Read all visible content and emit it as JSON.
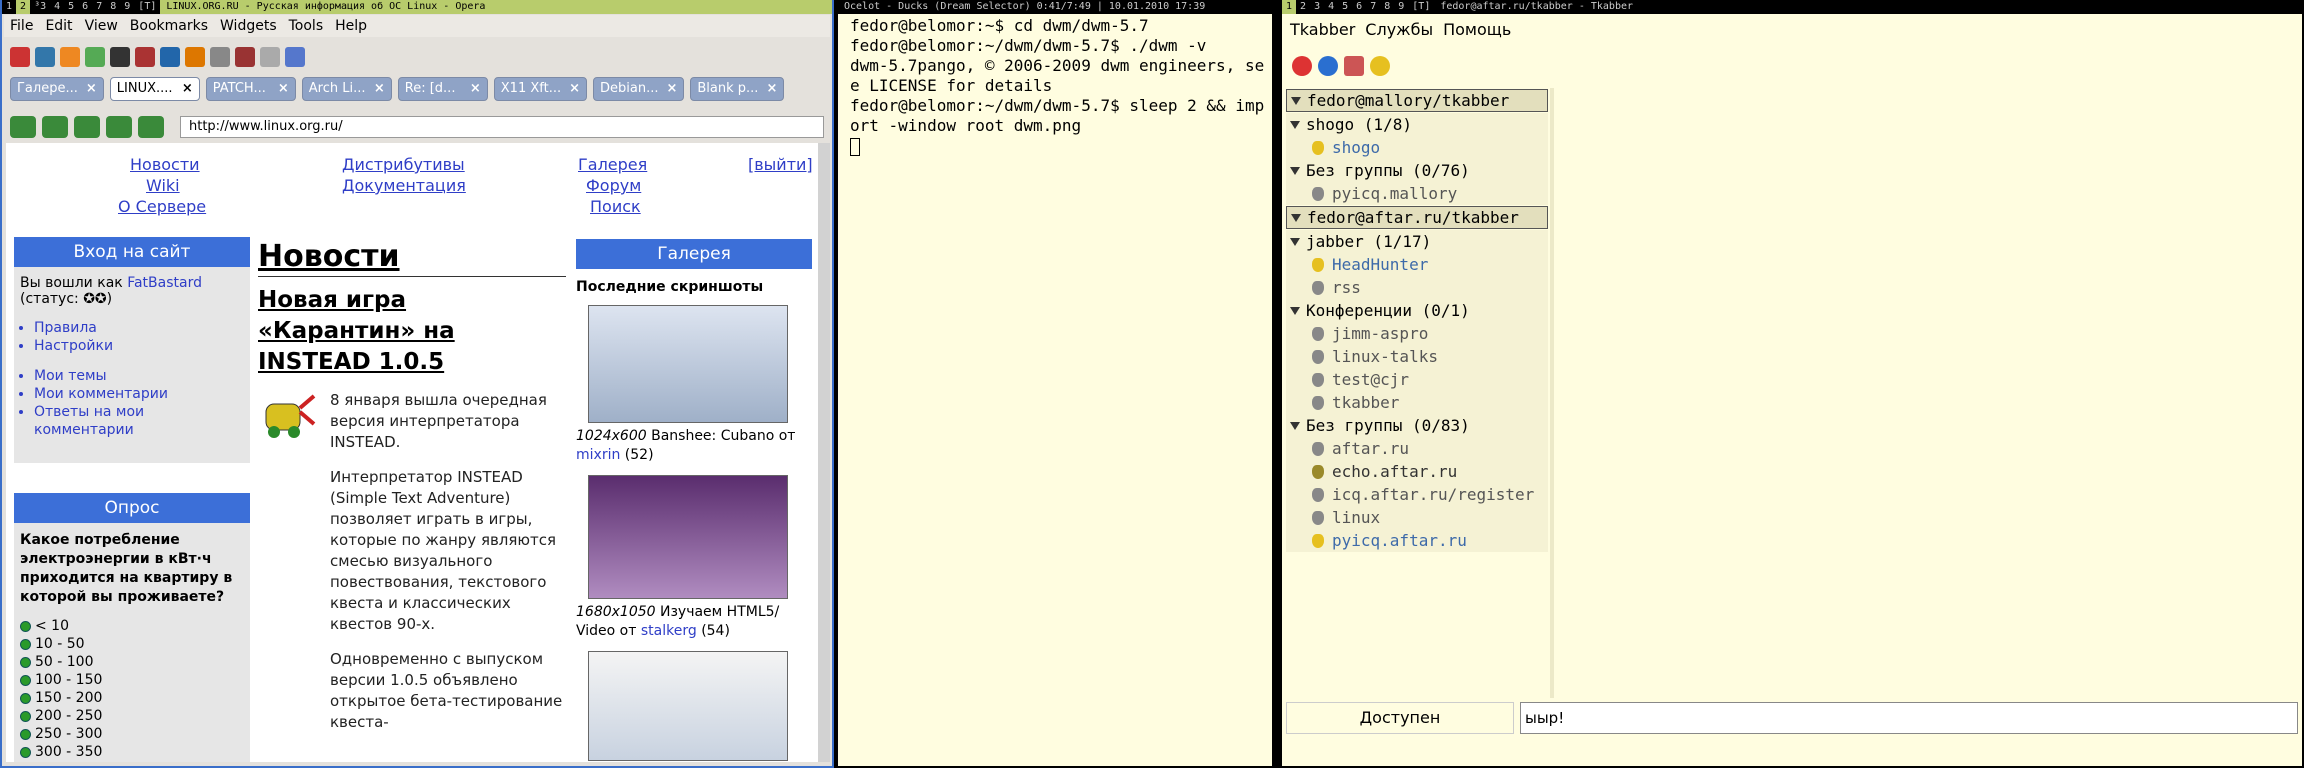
{
  "opera": {
    "bar": {
      "tags": [
        "1",
        "2",
        "³3",
        "4",
        "5",
        "6",
        "7",
        "8",
        "9",
        "[T]"
      ],
      "title": "LINUX.ORG.RU - Русская информация об ОС Linux - Opera"
    },
    "menu": [
      "File",
      "Edit",
      "View",
      "Bookmarks",
      "Widgets",
      "Tools",
      "Help"
    ],
    "tabs": [
      "Галере...",
      "LINUX....",
      "PATCH...",
      "Arch Li...",
      "Re: [d...",
      "X11 Xft...",
      "Debian...",
      "Blank p..."
    ],
    "url": "http://www.linux.org.ru/",
    "toplinks": [
      "Новости",
      "Wiki",
      "О Сервере",
      "Дистрибутивы",
      "Документация",
      "Галерея",
      "Форум",
      "Поиск",
      "[выйти]"
    ],
    "login": {
      "header": "Вход на сайт",
      "line1": "Вы вошли как",
      "user": "FatBastard",
      "status": "(статус: ✪✪)",
      "links": [
        "Правила",
        "Настройки"
      ],
      "links2": [
        "Мои темы",
        "Мои комментарии",
        "Ответы на мои комментарии"
      ]
    },
    "poll": {
      "header": "Опрос",
      "question": "Какое потребление электроэнергии в кВт·ч приходится на квартиру в которой вы проживаете?",
      "options": [
        "< 10",
        "10 - 50",
        "50 - 100",
        "100 - 150",
        "150 - 200",
        "200 - 250",
        "250 - 300",
        "300 - 350"
      ]
    },
    "news": {
      "heading": "Новости",
      "title": "Новая игра «Карантин» на INSTEAD 1.0.5",
      "p1": "8 января вышла очередная версия интерпретатора INSTEAD.",
      "p2": "Интерпретатор INSTEAD (Simple Text Adventure) позволяет играть в игры, которые по жанру являются смесью визуального повествования, текстового квеста и классических квестов 90-х.",
      "p3": "Одновременно с выпуском версии 1.0.5 объявлено открытое бета-тестирование квеста-"
    },
    "gallery": {
      "header": "Галерея",
      "sub": "Последние скриншоты",
      "items": [
        {
          "res": "1024x600",
          "text": "Banshee: Cubano от",
          "author": "mixrin",
          "count": "(52)"
        },
        {
          "res": "1680x1050",
          "text": "Изучаем HTML5/ Video от",
          "author": "stalkerg",
          "count": "(54)"
        }
      ]
    }
  },
  "terminal": {
    "bar": {
      "title": "Ocelot - Ducks (Dream Selector) 0:41/7:49 | 10.01.2010 17:39"
    },
    "lines": "fedor@belomor:~$ cd dwm/dwm-5.7\nfedor@belomor:~/dwm/dwm-5.7$ ./dwm -v\ndwm-5.7pango, © 2006-2009 dwm engineers, see LICENSE for details\nfedor@belomor:~/dwm/dwm-5.7$ sleep 2 && import -window root dwm.png\n"
  },
  "tkabber": {
    "bar": {
      "tags": [
        "1",
        "2",
        "3",
        "4",
        "5",
        "6",
        "7",
        "8",
        "9",
        "[T]"
      ],
      "title": "fedor@aftar.ru/tkabber - Tkabber"
    },
    "menu": [
      "Tkabber",
      "Службы",
      "Помощь"
    ],
    "roster": [
      {
        "kind": "acc",
        "text": "fedor@mallory/tkabber"
      },
      {
        "kind": "grp",
        "text": "shogo (1/8)"
      },
      {
        "kind": "online",
        "text": "shogo"
      },
      {
        "kind": "grp",
        "text": "Без группы (0/76)"
      },
      {
        "kind": "contact",
        "text": "pyicq.mallory"
      },
      {
        "kind": "acc",
        "text": "fedor@aftar.ru/tkabber"
      },
      {
        "kind": "grp",
        "text": "jabber (1/17)"
      },
      {
        "kind": "online",
        "text": "HeadHunter"
      },
      {
        "kind": "contact",
        "text": "rss"
      },
      {
        "kind": "grp",
        "text": "Конференции (0/1)"
      },
      {
        "kind": "contact",
        "text": "jimm-aspro"
      },
      {
        "kind": "contact",
        "text": "linux-talks"
      },
      {
        "kind": "contact",
        "text": "test@cjr"
      },
      {
        "kind": "contact",
        "text": "tkabber"
      },
      {
        "kind": "grp",
        "text": "Без группы (0/83)"
      },
      {
        "kind": "contact",
        "text": "aftar.ru"
      },
      {
        "kind": "on2",
        "text": "echo.aftar.ru"
      },
      {
        "kind": "contact",
        "text": "icq.aftar.ru/register"
      },
      {
        "kind": "contact",
        "text": "linux"
      },
      {
        "kind": "online",
        "text": "pyicq.aftar.ru"
      }
    ],
    "status": "Доступен",
    "input": "ыыр!"
  }
}
